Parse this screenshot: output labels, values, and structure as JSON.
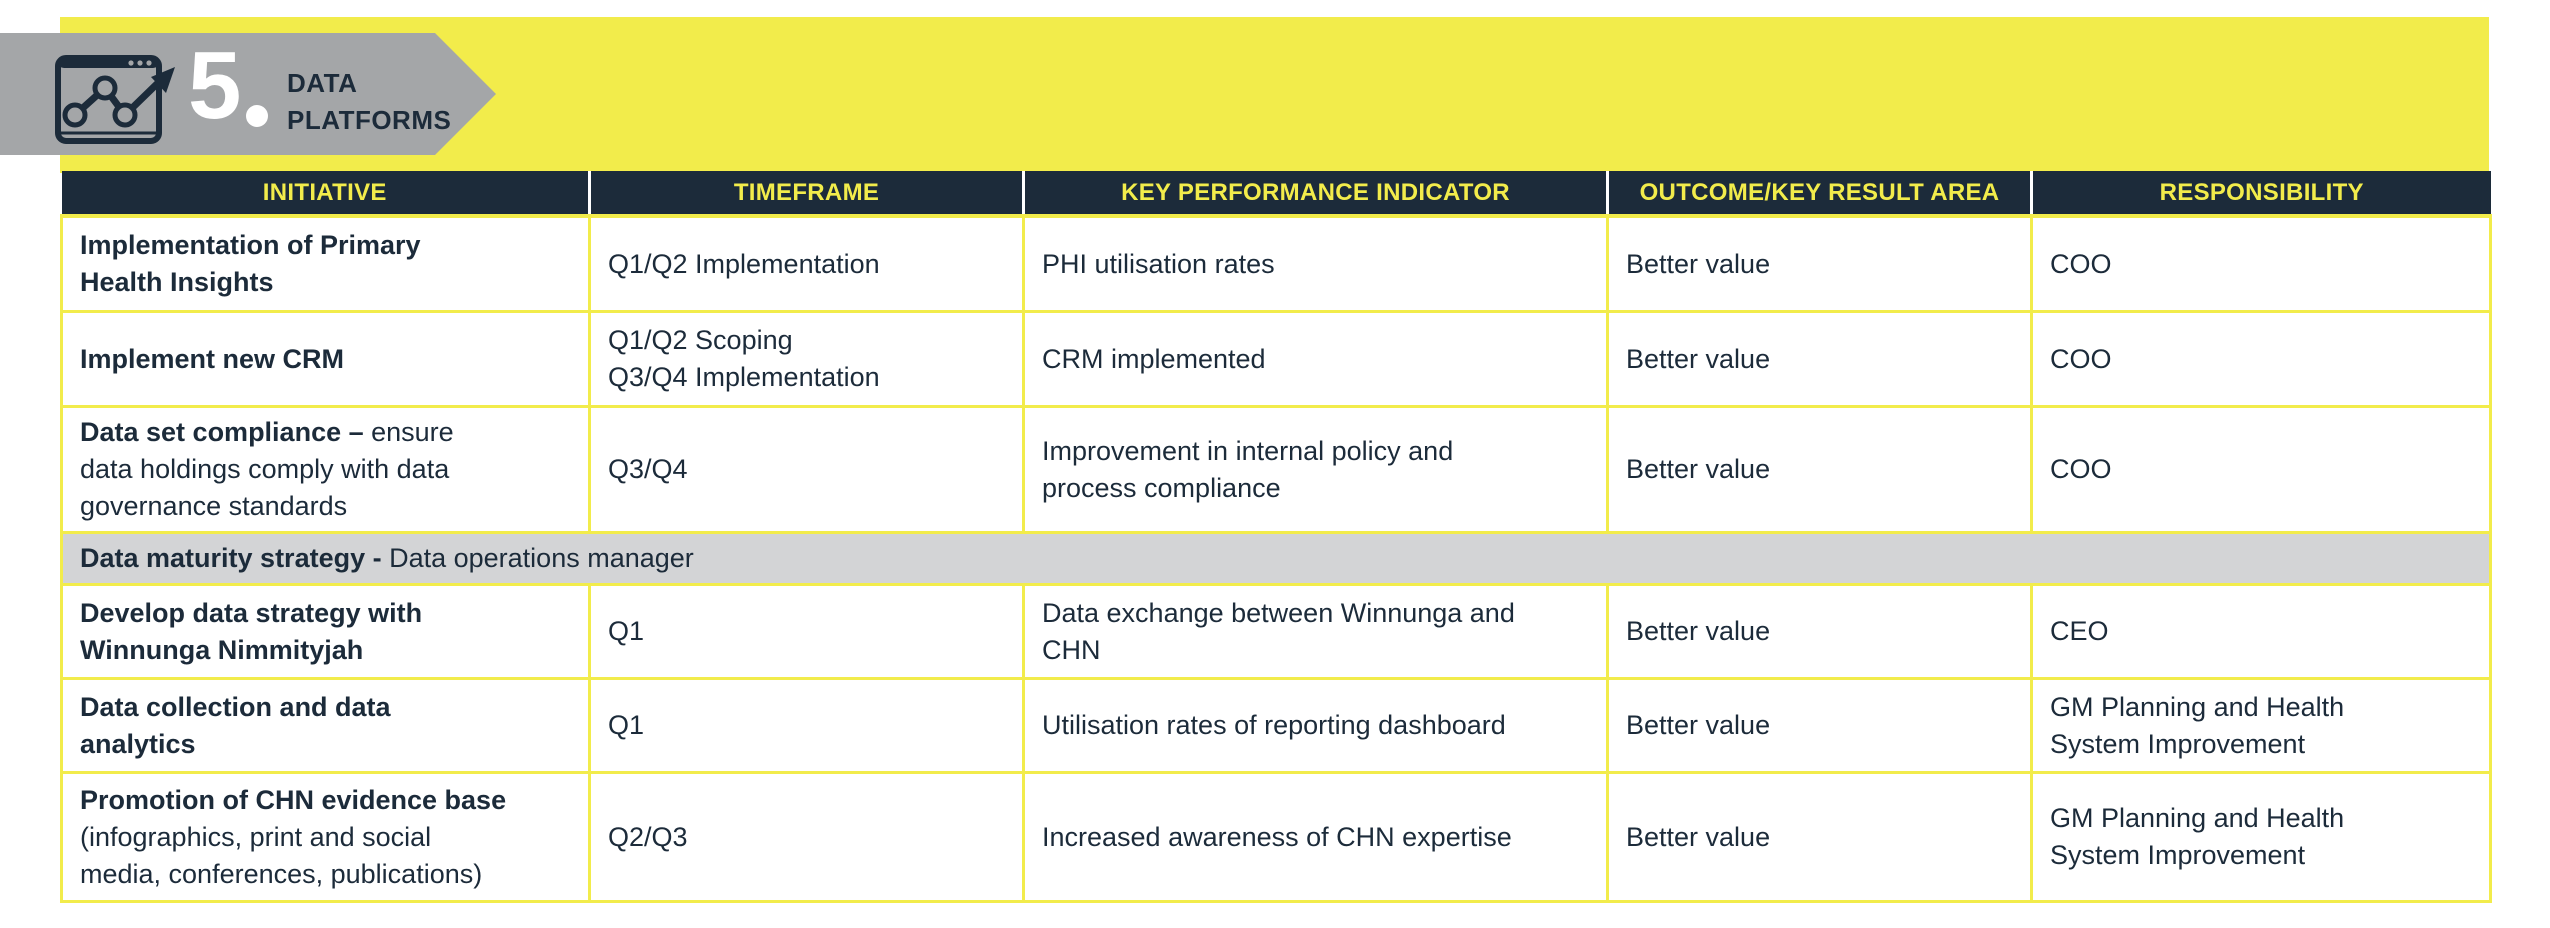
{
  "section": {
    "number": "5",
    "title_line1": "DATA",
    "title_line2": "PLATFORMS",
    "icon": "chart-window-trend-icon",
    "colors": {
      "band": "#f2ec4b",
      "banner": "#a4a6a8",
      "header_bg": "#1c2b3a",
      "header_text": "#f2ec4b",
      "subsection_bg": "#d3d4d6",
      "text": "#1c2b3a"
    }
  },
  "table": {
    "headers": [
      "INITIATIVE",
      "TIMEFRAME",
      "KEY PERFORMANCE INDICATOR",
      "OUTCOME/KEY RESULT AREA",
      "RESPONSIBILITY"
    ],
    "rows": [
      {
        "initiative_lines": [
          "Implementation of Primary",
          "Health Insights"
        ],
        "timeframe_lines": [
          "Q1/Q2 Implementation"
        ],
        "kpi_lines": [
          "PHI utilisation rates"
        ],
        "outcome": "Better value",
        "responsibility_lines": [
          "COO"
        ]
      },
      {
        "initiative_lines": [
          "Implement new CRM"
        ],
        "timeframe_lines": [
          "Q1/Q2 Scoping",
          "Q3/Q4 Implementation"
        ],
        "kpi_lines": [
          "CRM implemented"
        ],
        "outcome": "Better value",
        "responsibility_lines": [
          "COO"
        ]
      },
      {
        "initiative_bold": "Data set compliance –",
        "initiative_rest_line1": " ensure",
        "initiative_lines_more": [
          "data holdings comply with data",
          "governance standards"
        ],
        "timeframe_lines": [
          "Q3/Q4"
        ],
        "kpi_lines": [
          "Improvement in internal policy and",
          "process compliance"
        ],
        "outcome": "Better value",
        "responsibility_lines": [
          "COO"
        ]
      }
    ],
    "subsection": {
      "lead": "Data maturity strategy -",
      "rest": " Data operations manager"
    },
    "rows_after": [
      {
        "initiative_lines": [
          "Develop data strategy with",
          "Winnunga Nimmityjah"
        ],
        "timeframe_lines": [
          "Q1"
        ],
        "kpi_lines": [
          "Data exchange between Winnunga and",
          "CHN"
        ],
        "outcome": "Better value",
        "responsibility_lines": [
          "CEO"
        ]
      },
      {
        "initiative_lines": [
          "Data collection and data",
          "analytics"
        ],
        "timeframe_lines": [
          "Q1"
        ],
        "kpi_lines": [
          "Utilisation rates of reporting dashboard"
        ],
        "outcome": "Better value",
        "responsibility_lines": [
          "GM Planning and Health",
          "System Improvement"
        ]
      },
      {
        "initiative_bold": "Promotion of CHN evidence base",
        "initiative_lines_more": [
          "(infographics, print and social",
          "media, conferences, publications)"
        ],
        "timeframe_lines": [
          "Q2/Q3"
        ],
        "kpi_lines": [
          "Increased awareness of CHN expertise"
        ],
        "outcome": "Better value",
        "responsibility_lines": [
          "GM Planning and Health",
          "System Improvement"
        ]
      }
    ]
  }
}
